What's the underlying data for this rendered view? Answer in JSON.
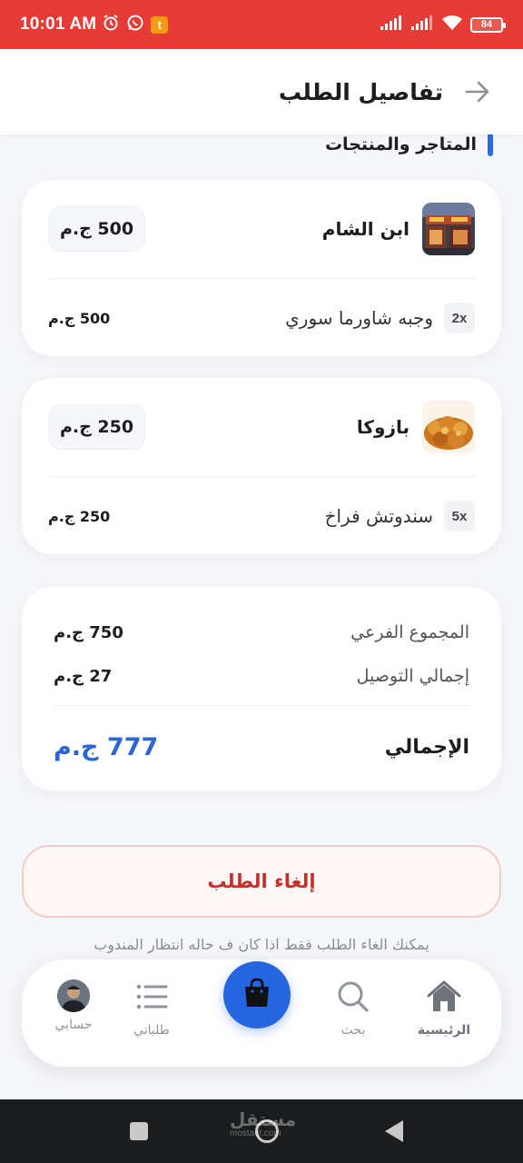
{
  "status_bar": {
    "time": "10:01 AM",
    "battery": "84",
    "icons": [
      "alarm-icon",
      "whatsapp-icon",
      "app-t-icon",
      "signal-icon",
      "signal-icon-2",
      "wifi-icon",
      "battery-icon"
    ]
  },
  "header": {
    "title": "تفاصيل الطلب",
    "back_icon": "arrow-back-icon"
  },
  "section": {
    "title": "المتاجر والمنتجات",
    "accent_color": "#2d6be4"
  },
  "stores": [
    {
      "name": "ابن الشام",
      "total": "500 ج.م",
      "image": "storefront-photo",
      "items": [
        {
          "qty": "2x",
          "name": "وجبه شاورما سوري",
          "price": "500 ج.م"
        }
      ]
    },
    {
      "name": "بازوكا",
      "total": "250 ج.م",
      "image": "fried-chicken-photo",
      "items": [
        {
          "qty": "5x",
          "name": "سندوتش فراخ",
          "price": "250 ج.م"
        }
      ]
    }
  ],
  "summary": {
    "subtotal_label": "المجموع الفرعي",
    "subtotal_value": "750 ج.م",
    "delivery_label": "إجمالي التوصيل",
    "delivery_value": "27 ج.م",
    "total_label": "الإجمالي",
    "total_value": "777 ج.م",
    "total_color": "#2c66d6"
  },
  "actions": {
    "cancel_label": "إلغاء الطلب",
    "cancel_note": "يمكنك الغاء الطلب فقط اذا كان ف حاله انتظار المندوب",
    "cancel_color": "#c6302b"
  },
  "bottom_nav": {
    "home": {
      "label": "الرئيسية",
      "icon": "home-icon"
    },
    "search": {
      "label": "بحث",
      "icon": "search-icon"
    },
    "cart": {
      "icon": "shopping-bag-icon"
    },
    "orders": {
      "label": "طلباتي",
      "icon": "list-icon"
    },
    "account": {
      "label": "حسابي",
      "icon": "avatar"
    }
  },
  "watermark": {
    "text": "مستقل",
    "sub": "mostaql.com"
  }
}
